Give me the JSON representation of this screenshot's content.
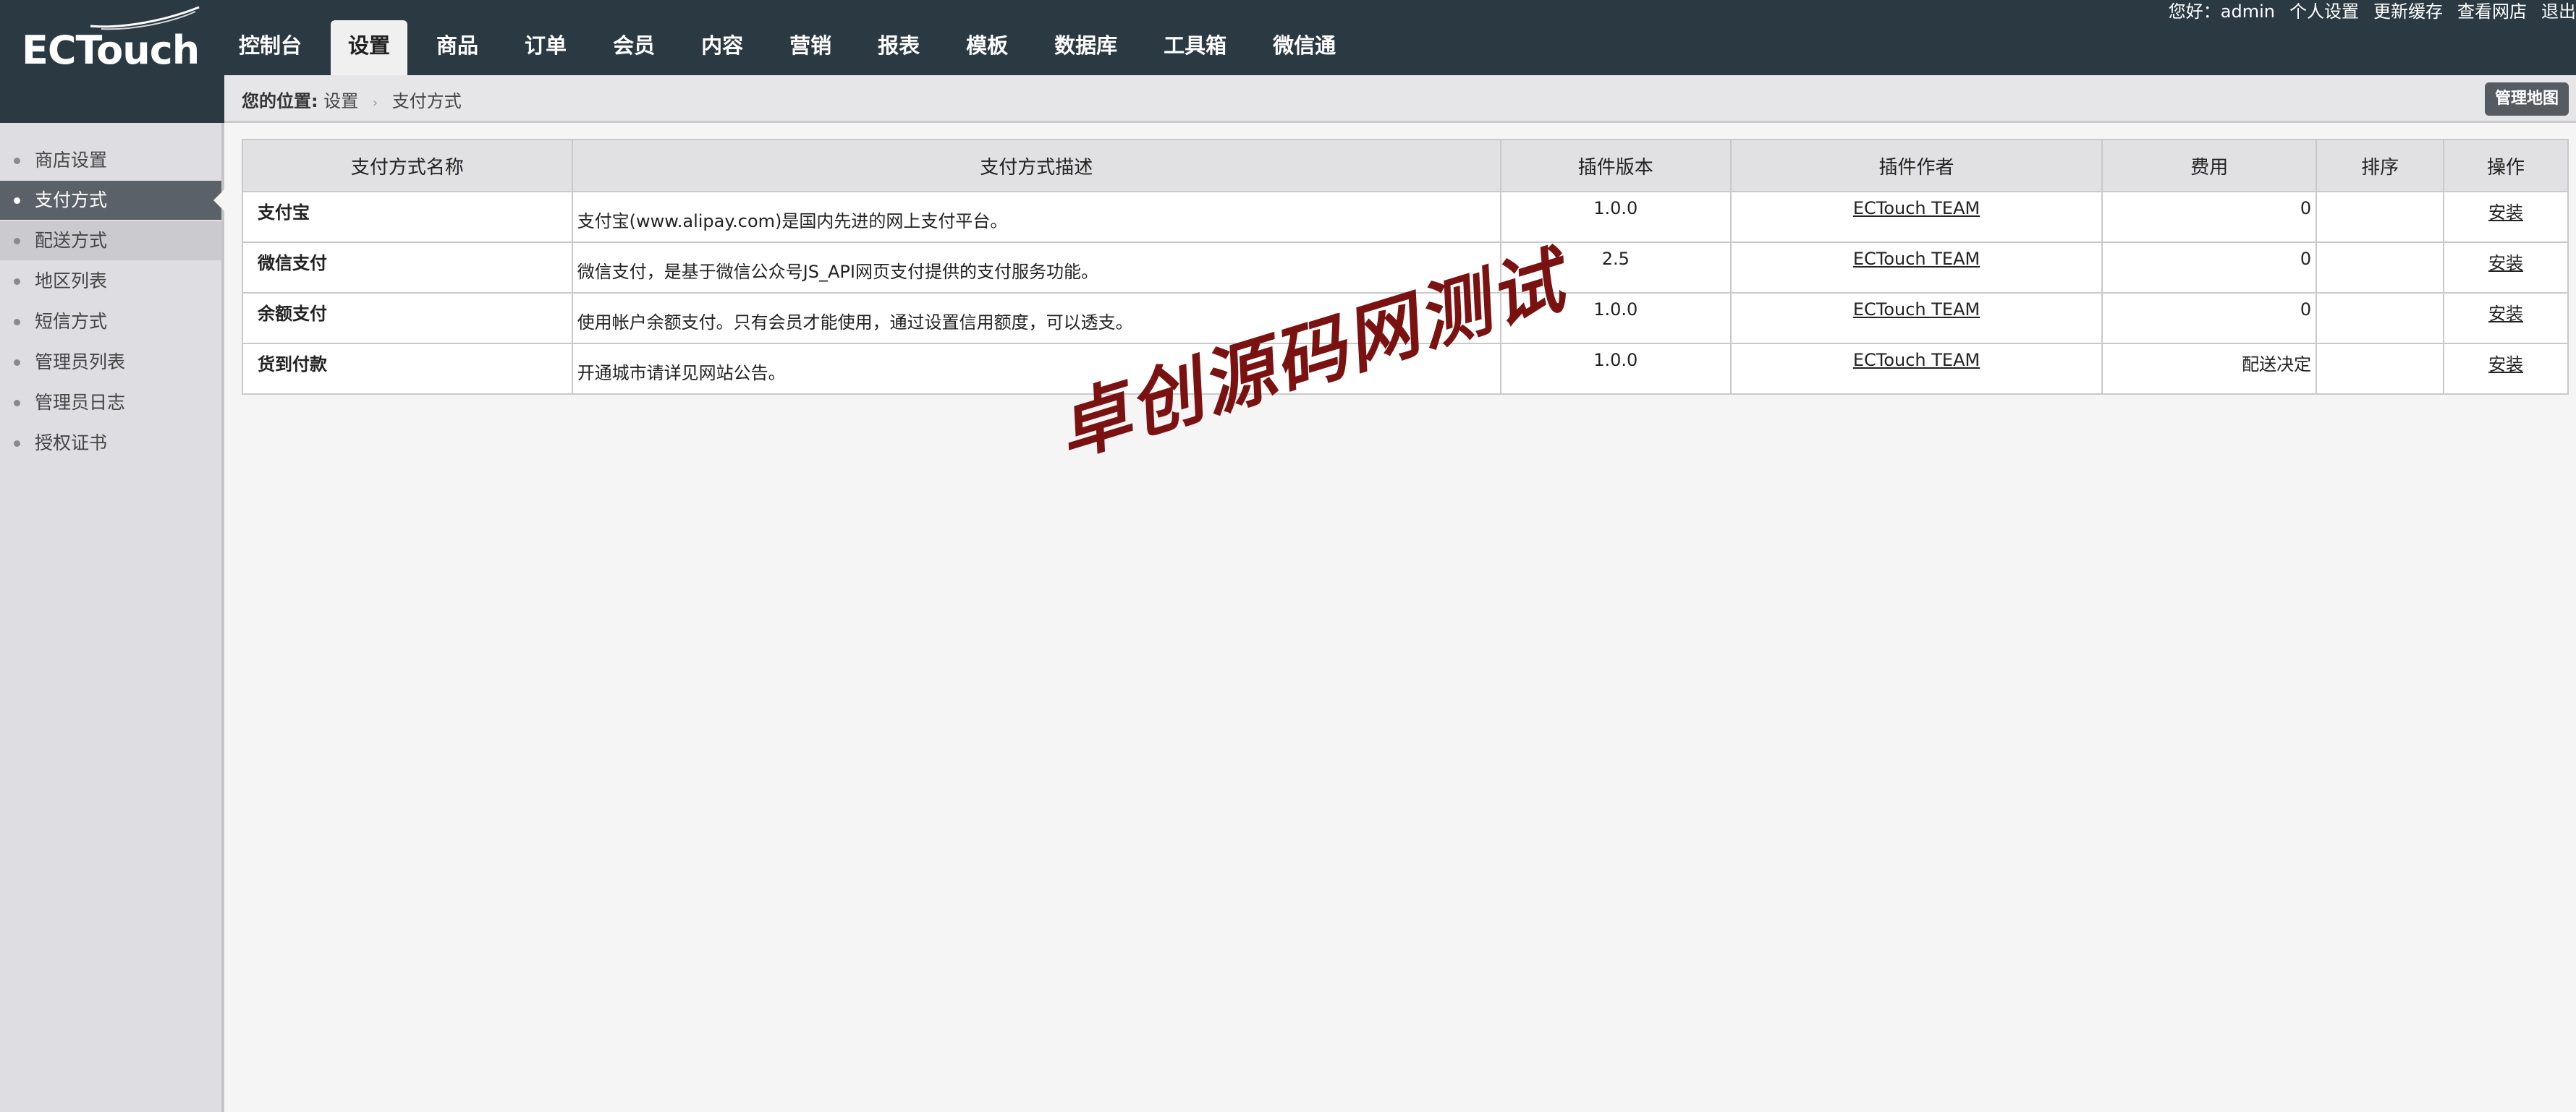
{
  "header": {
    "logo_text": "ECTouch",
    "nav": [
      {
        "label": "控制台",
        "active": false
      },
      {
        "label": "设置",
        "active": true
      },
      {
        "label": "商品",
        "active": false
      },
      {
        "label": "订单",
        "active": false
      },
      {
        "label": "会员",
        "active": false
      },
      {
        "label": "内容",
        "active": false
      },
      {
        "label": "营销",
        "active": false
      },
      {
        "label": "报表",
        "active": false
      },
      {
        "label": "模板",
        "active": false
      },
      {
        "label": "数据库",
        "active": false
      },
      {
        "label": "工具箱",
        "active": false
      },
      {
        "label": "微信通",
        "active": false
      }
    ],
    "user_links": {
      "greeting": "您好：admin",
      "profile": "个人设置",
      "clear_cache": "更新缓存",
      "view_site": "查看网店",
      "logout": "退出"
    }
  },
  "breadcrumb": {
    "label": "您的位置:",
    "level1": "设置",
    "level2": "支付方式",
    "sitemap_button": "管理地图"
  },
  "sidebar": {
    "items": [
      {
        "label": "商店设置"
      },
      {
        "label": "支付方式",
        "active": true
      },
      {
        "label": "配送方式"
      },
      {
        "label": "地区列表"
      },
      {
        "label": "短信方式"
      },
      {
        "label": "管理员列表"
      },
      {
        "label": "管理员日志"
      },
      {
        "label": "授权证书"
      }
    ]
  },
  "table": {
    "headers": [
      "支付方式名称",
      "支付方式描述",
      "插件版本",
      "插件作者",
      "费用",
      "排序",
      "操作"
    ],
    "rows": [
      {
        "name": "支付宝",
        "desc": "支付宝(www.alipay.com)是国内先进的网上支付平台。",
        "version": "1.0.0",
        "author": "ECTouch TEAM",
        "fee": "0",
        "sort": "",
        "action": "安装"
      },
      {
        "name": "微信支付",
        "desc": "微信支付，是基于微信公众号JS_API网页支付提供的支付服务功能。",
        "version": "2.5",
        "author": "ECTouch TEAM",
        "fee": "0",
        "sort": "",
        "action": "安装"
      },
      {
        "name": "余额支付",
        "desc": "使用帐户余额支付。只有会员才能使用，通过设置信用额度，可以透支。",
        "version": "1.0.0",
        "author": "ECTouch TEAM",
        "fee": "0",
        "sort": "",
        "action": "安装"
      },
      {
        "name": "货到付款",
        "desc": "开通城市请详见网站公告。",
        "version": "1.0.0",
        "author": "ECTouch TEAM",
        "fee": "配送决定",
        "sort": "",
        "action": "安装"
      }
    ]
  },
  "watermark": "卓创源码网测试",
  "colors": {
    "header_bg": "#2b3a42",
    "sidebar_bg": "#dedee2",
    "sidebar_active": "#5b6168",
    "watermark": "#7a1212"
  }
}
